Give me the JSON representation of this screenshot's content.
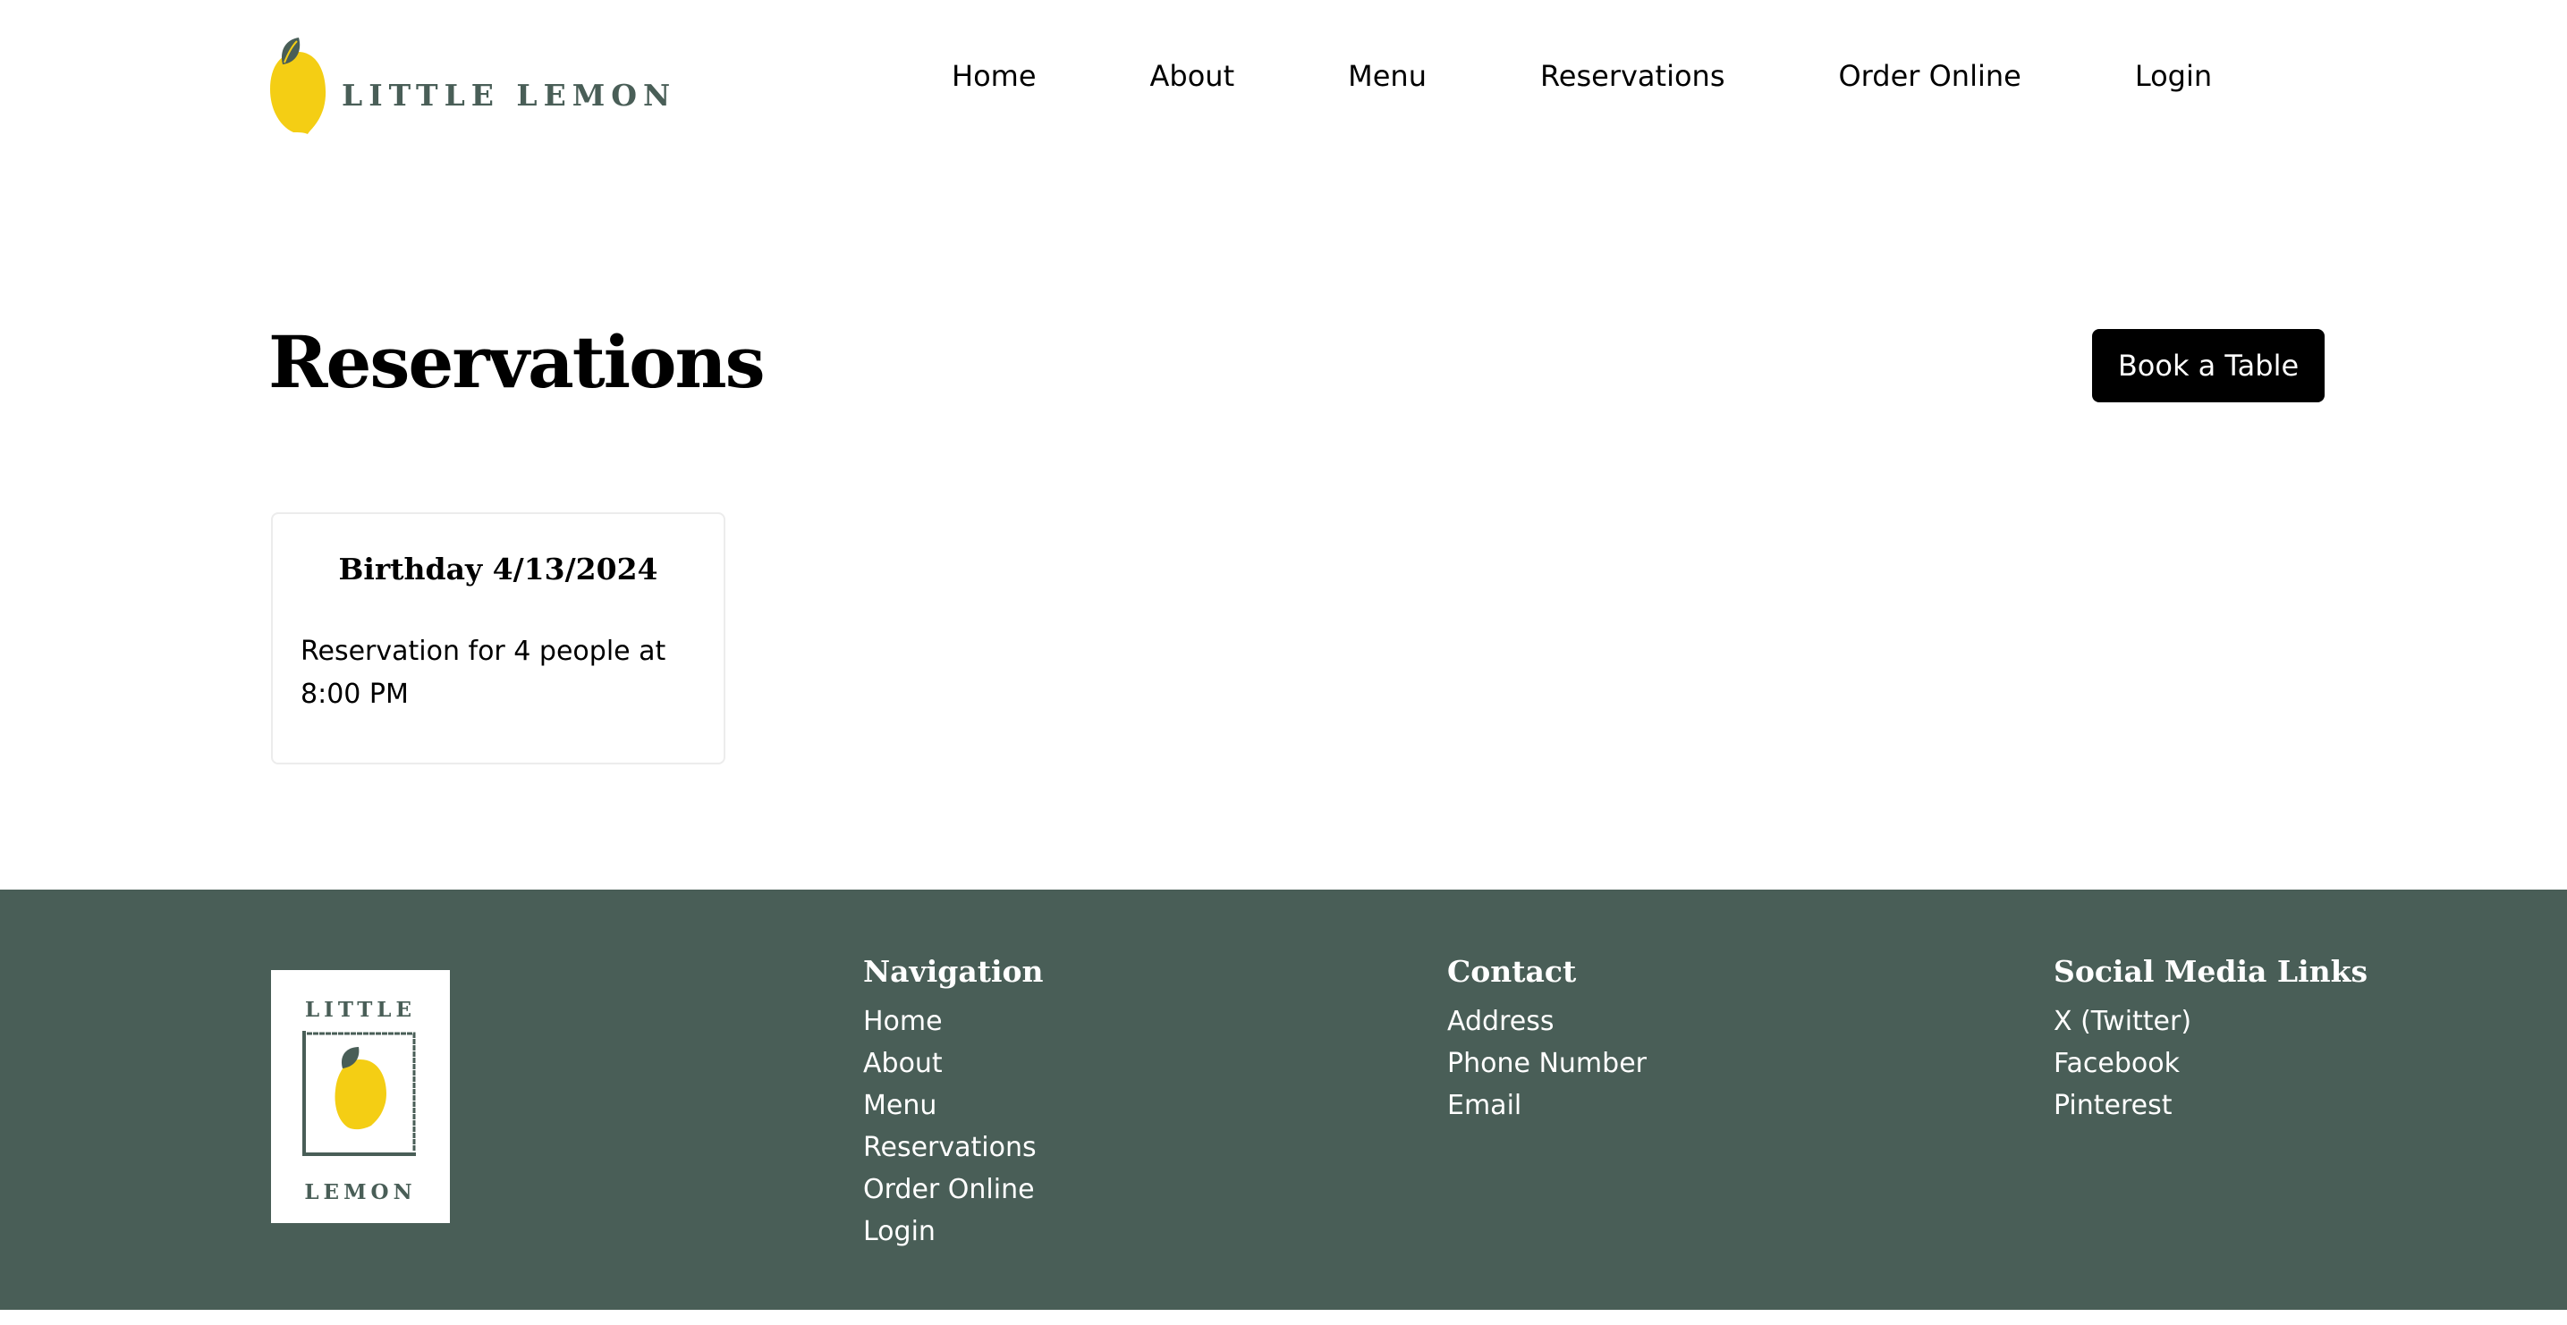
{
  "brand": {
    "name": "LITTLE LEMON",
    "footer_logo_top": "LITTLE",
    "footer_logo_bottom": "LEMON",
    "colors": {
      "primary": "#495e57",
      "lemon": "#f4ce14",
      "leaf": "#495e57"
    }
  },
  "nav": {
    "items": [
      {
        "label": "Home"
      },
      {
        "label": "About"
      },
      {
        "label": "Menu"
      },
      {
        "label": "Reservations"
      },
      {
        "label": "Order Online"
      },
      {
        "label": "Login"
      }
    ]
  },
  "main": {
    "title": "Reservations",
    "book_button": "Book a Table",
    "reservations": [
      {
        "title": "Birthday 4/13/2024",
        "body": "Reservation for 4 people at 8:00 PM"
      }
    ]
  },
  "footer": {
    "navigation": {
      "heading": "Navigation",
      "links": [
        "Home",
        "About",
        "Menu",
        "Reservations",
        "Order Online",
        "Login"
      ]
    },
    "contact": {
      "heading": "Contact",
      "links": [
        "Address",
        "Phone Number",
        "Email"
      ]
    },
    "social": {
      "heading": "Social Media Links",
      "links": [
        "X (Twitter)",
        "Facebook",
        "Pinterest"
      ]
    }
  }
}
